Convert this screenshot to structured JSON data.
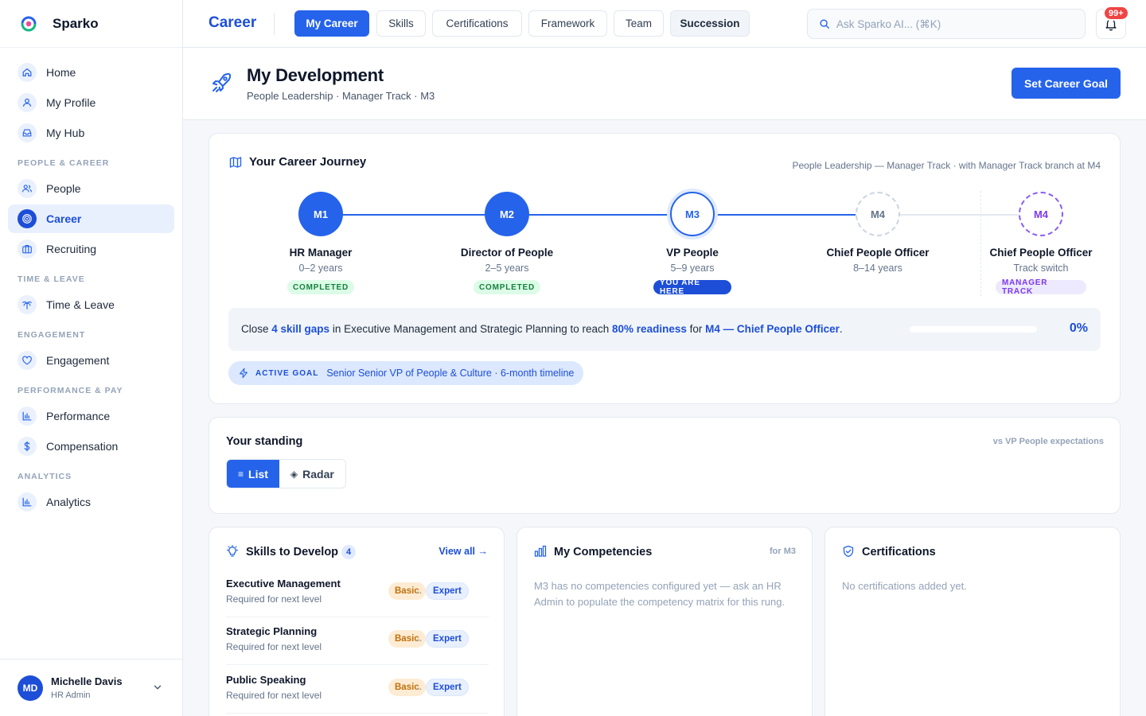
{
  "brand": {
    "name": "Sparko"
  },
  "sidebar": {
    "items_top": [
      {
        "label": "Home",
        "icon": "home-icon"
      },
      {
        "label": "My Profile",
        "icon": "user-icon"
      },
      {
        "label": "My Hub",
        "icon": "inbox-icon"
      }
    ],
    "sections": [
      {
        "title": "People & Career",
        "items": [
          {
            "label": "People",
            "icon": "users-icon"
          },
          {
            "label": "Career",
            "icon": "target-icon",
            "active": true
          },
          {
            "label": "Recruiting",
            "icon": "briefcase-icon"
          }
        ]
      },
      {
        "title": "Time & Leave",
        "items": [
          {
            "label": "Time & Leave",
            "icon": "palm-tree-icon"
          }
        ]
      },
      {
        "title": "Engagement",
        "items": [
          {
            "label": "Engagement",
            "icon": "heart-icon"
          }
        ]
      },
      {
        "title": "Performance & Pay",
        "items": [
          {
            "label": "Performance",
            "icon": "bar-chart-icon"
          },
          {
            "label": "Compensation",
            "icon": "dollar-icon"
          }
        ]
      },
      {
        "title": "Analytics",
        "items": [
          {
            "label": "Analytics",
            "icon": "bar-chart-icon"
          }
        ]
      }
    ],
    "user": {
      "initials": "MD",
      "name": "Michelle Davis",
      "role": "HR Admin"
    }
  },
  "topbar": {
    "title": "Career",
    "tabs": [
      "My Career",
      "Skills",
      "Certifications",
      "Framework",
      "Team",
      "Succession"
    ],
    "active_tab": "My Career",
    "search_placeholder": "Ask Sparko AI... (⌘K)",
    "notification_count": "99+"
  },
  "page": {
    "title": "My Development",
    "subtitle": "People Leadership · Manager Track · M3",
    "primary_button": "Set Career Goal"
  },
  "journey": {
    "title": "Your Career Journey",
    "meta": "People Leadership — Manager Track · with Manager Track branch at M4",
    "steps": [
      {
        "code": "M1",
        "title": "HR Manager",
        "years": "0–2 years",
        "status": "Completed"
      },
      {
        "code": "M2",
        "title": "Director of People",
        "years": "2–5 years",
        "status": "Completed"
      },
      {
        "code": "M3",
        "title": "VP People",
        "years": "5–9 years",
        "status": "You are here"
      },
      {
        "code": "M4",
        "title": "Chief People Officer",
        "years": "8–14 years",
        "status": ""
      },
      {
        "code": "M4",
        "title": "Chief People Officer",
        "years": "Track switch",
        "status": "Manager Track"
      }
    ],
    "readiness": {
      "pre1": "Close ",
      "gaps": "4 skill gaps",
      "pre2": " in Executive Management and Strategic Planning to reach ",
      "target": "80% readiness",
      "pre3": " for ",
      "role": "M4 — Chief People Officer",
      "post": ".",
      "percent_label": "0%",
      "progress": 0
    },
    "active_goal": {
      "tag": "Active Goal",
      "text": "Senior Senior VP of People & Culture · 6-month timeline"
    }
  },
  "standing": {
    "title": "Your standing",
    "meta": "vs VP People expectations",
    "views": [
      "List",
      "Radar"
    ],
    "active_view": "List"
  },
  "skills": {
    "title": "Skills to Develop",
    "count": "4",
    "view_all": "View all →",
    "rows": [
      {
        "name": "Executive Management",
        "note": "Required for next level",
        "from": "Basic",
        "to": "Expert"
      },
      {
        "name": "Strategic Planning",
        "note": "Required for next level",
        "from": "Basic",
        "to": "Expert"
      },
      {
        "name": "Public Speaking",
        "note": "Required for next level",
        "from": "Basic",
        "to": "Expert"
      }
    ]
  },
  "competencies": {
    "title": "My Competencies",
    "meta": "for M3",
    "empty": "M3 has no competencies configured yet — ask an HR Admin to populate the competency matrix for this rung."
  },
  "certifications": {
    "title": "Certifications",
    "empty": "No certifications added yet."
  },
  "colors": {
    "accent": "#2563eb",
    "accent_dark": "#1d4ed8",
    "success": "#15803d",
    "branch": "#7c3aed",
    "warning": "#c2700c",
    "badge": "#ef4444"
  }
}
